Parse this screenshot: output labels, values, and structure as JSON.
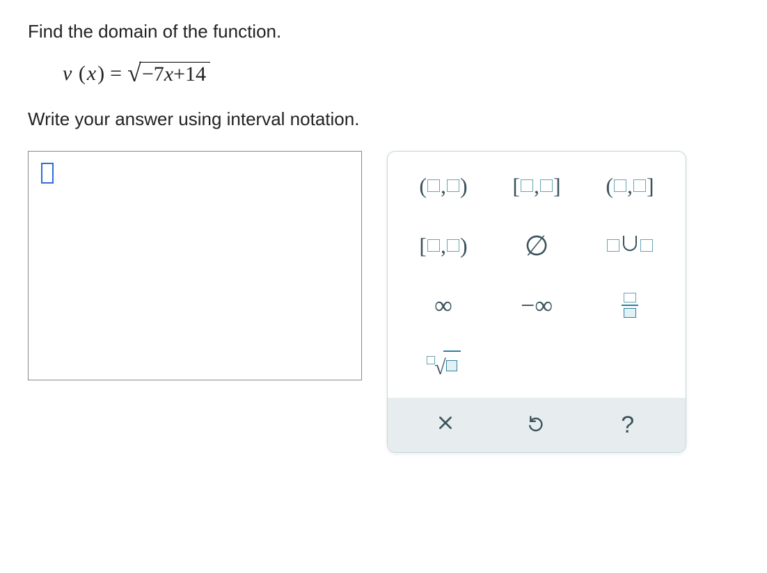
{
  "prompt": {
    "line1": "Find the domain of the function.",
    "line2": "Write your answer using interval notation."
  },
  "equation": {
    "lhs_var": "v",
    "lhs_arg": "x",
    "radicand": "−7x+14",
    "radicand_minus": "−7",
    "radicand_x": "x",
    "radicand_plus14": "+14"
  },
  "answer": {
    "value": ""
  },
  "keypad": {
    "open_open": "(□,□)",
    "closed_closed": "[□,□]",
    "open_closed": "(□,□]",
    "closed_open": "[□,□)",
    "empty_set": "∅",
    "union": "□∪□",
    "infinity": "∞",
    "neg_infinity": "−∞",
    "fraction": "□/□",
    "nth_root": "□√□"
  },
  "footer": {
    "clear": "×",
    "undo": "↺",
    "help": "?"
  }
}
